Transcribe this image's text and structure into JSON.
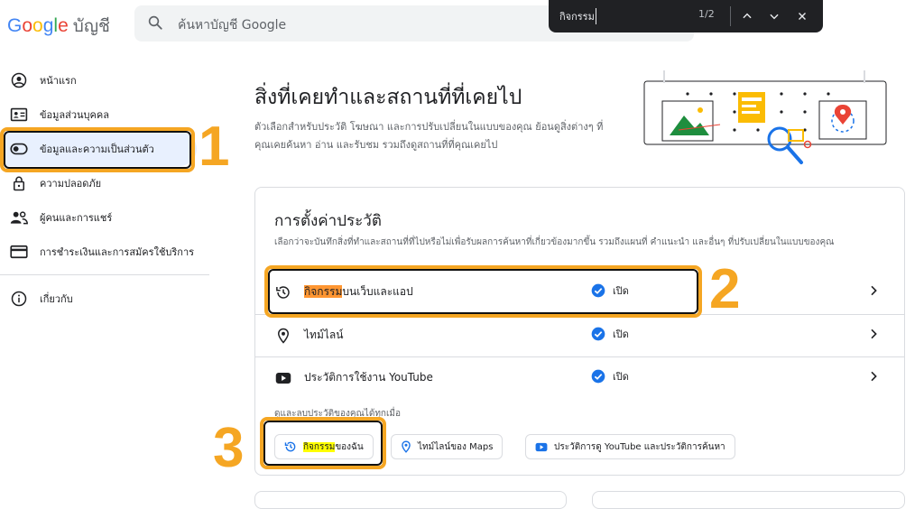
{
  "header": {
    "logo_letters": [
      "G",
      "o",
      "o",
      "g",
      "l",
      "e"
    ],
    "product": "บัญชี",
    "search_placeholder": "ค้นหาบัญชี Google"
  },
  "findbar": {
    "query": "กิจกรรม",
    "count": "1/2"
  },
  "sidebar": {
    "items": [
      {
        "label": "หน้าแรก",
        "icon": "account-circle-icon"
      },
      {
        "label": "ข้อมูลส่วนบุคคล",
        "icon": "id-card-icon"
      },
      {
        "label": "ข้อมูลและความเป็นส่วนตัว",
        "icon": "toggle-icon",
        "active": true
      },
      {
        "label": "ความปลอดภัย",
        "icon": "lock-icon"
      },
      {
        "label": "ผู้คนและการแชร์",
        "icon": "people-icon"
      },
      {
        "label": "การชำระเงินและการสมัครใช้บริการ",
        "icon": "credit-card-icon"
      },
      {
        "label": "เกี่ยวกับ",
        "icon": "info-icon"
      }
    ]
  },
  "main": {
    "title": "สิ่งที่เคยทำและสถานที่ที่เคยไป",
    "description": "ตัวเลือกสำหรับประวัติ โฆษณา และการปรับเปลี่ยนในแบบของคุณ ย้อนดูสิ่งต่างๆ ที่คุณเคยค้นหา อ่าน และรับชม รวมถึงดูสถานที่ที่คุณเคยไป"
  },
  "history_card": {
    "title": "การตั้งค่าประวัติ",
    "description": "เลือกว่าจะบันทึกสิ่งที่ทำและสถานที่ที่ไปหรือไม่เพื่อรับผลการค้นหาที่เกี่ยวข้องมากขึ้น รวมถึงแผนที่ คำแนะนำ และอื่นๆ ที่ปรับเปลี่ยนในแบบของคุณ",
    "rows": [
      {
        "label_highlight": "กิจกรรม",
        "label_rest": "บนเว็บและแอป",
        "status": "เปิด",
        "icon": "history-icon"
      },
      {
        "label_highlight": "",
        "label_rest": "ไทม์ไลน์",
        "status": "เปิด",
        "icon": "location-pin-icon"
      },
      {
        "label_highlight": "",
        "label_rest": "ประวัติการใช้งาน YouTube",
        "status": "เปิด",
        "icon": "youtube-icon"
      }
    ],
    "manage_label": "ดูและลบประวัติของคุณได้ทุกเมื่อ",
    "chips": [
      {
        "label_highlight": "กิจกรรม",
        "label_rest": "ของฉัน",
        "icon": "history-icon"
      },
      {
        "label_highlight": "",
        "label_rest": "ไทม์ไลน์ของ Maps",
        "icon": "location-pin-icon"
      },
      {
        "label_highlight": "",
        "label_rest": "ประวัติการดู YouTube และประวัติการค้นหา",
        "icon": "youtube-icon"
      }
    ]
  },
  "annotations": {
    "one": "1",
    "two": "2",
    "three": "3",
    "color": "#f5a623"
  },
  "colors": {
    "accent": "#1a73e8",
    "highlight_orange": "#ff9632",
    "highlight_yellow": "#ffff00",
    "active_bg": "#e8f0fe"
  }
}
